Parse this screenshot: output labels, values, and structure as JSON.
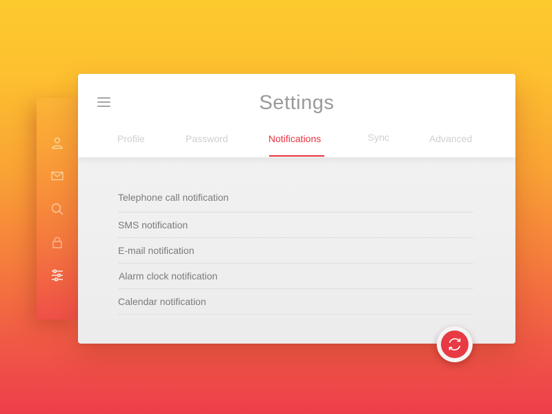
{
  "app": {
    "title": "Settings"
  },
  "sidebar": {
    "items": [
      {
        "icon": "user-icon",
        "label": ""
      },
      {
        "icon": "mail-icon",
        "label": ""
      },
      {
        "icon": "search-icon",
        "label": ""
      },
      {
        "icon": "lock-icon",
        "label": ""
      },
      {
        "icon": "sliders-icon",
        "label": "",
        "active": true
      }
    ]
  },
  "tabs": [
    {
      "label": "Profile"
    },
    {
      "label": "Password"
    },
    {
      "label": "Notifications",
      "active": true
    },
    {
      "label": "Sync"
    },
    {
      "label": "Advanced"
    }
  ],
  "notifications": [
    "Telephone call notification",
    "SMS notification",
    "E-mail notification",
    "Alarm clock notification",
    "Calendar notification"
  ],
  "fab": {
    "icon": "sync-icon"
  },
  "colors": {
    "accent": "#e8323f",
    "gradient_top": "#fdca2e",
    "gradient_bottom": "#ed3e4b",
    "title_text": "#9a9a9a",
    "inactive_tab": "#cfcfcf",
    "item_text": "#7a7a7a"
  }
}
